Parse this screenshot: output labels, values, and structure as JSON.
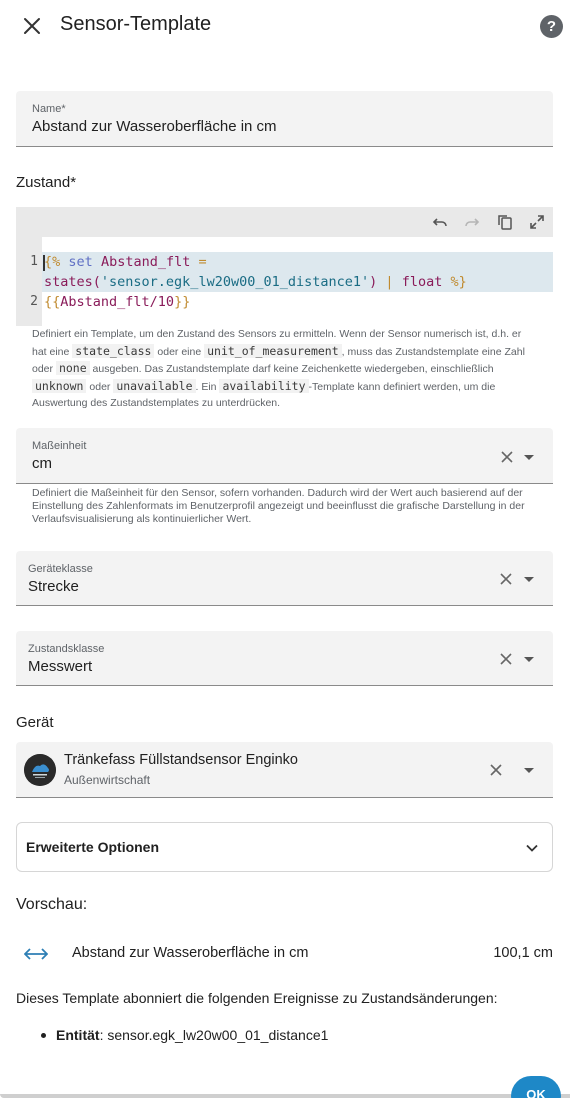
{
  "dialog": {
    "title": "Sensor-Template",
    "help_label": "?"
  },
  "name_field": {
    "label": "Name*",
    "value": "Abstand zur Wasseroberfläche in cm"
  },
  "state": {
    "section_label": "Zustand*",
    "code_lines": [
      {
        "number": "1"
      },
      {
        "number": "2"
      }
    ],
    "code": {
      "l1a_open": "{%",
      "l1a_kw": "set",
      "l1a_var": "Abstand_flt",
      "l1a_eq": "=",
      "l1b_fn": "states(",
      "l1b_str": "'sensor.egk_lw20w00_01_distance1'",
      "l1b_close": ")",
      "l1b_pipe": "|",
      "l1b_filter": "float",
      "l1b_end": "%}",
      "l2_open": "{{",
      "l2_expr": "Abstand_flt/10",
      "l2_close": "}}"
    },
    "helper": {
      "t1": "Definiert ein Template, um den Zustand des Sensors zu ermitteln. Wenn der Sensor numerisch ist, d.h. er hat eine ",
      "c1": "state_class",
      "t2": " oder eine ",
      "c2": "unit_of_measurement",
      "t3": ", muss das Zustandstemplate eine Zahl oder ",
      "c3": "none",
      "t4": " ausgeben. Das Zustandstemplate darf keine Zeichenkette wiedergeben, einschließlich ",
      "c4": "unknown",
      "t5": " oder ",
      "c5": "unavailable",
      "t6": ". Ein ",
      "c6": "availability",
      "t7": "-Template kann definiert werden, um die Auswertung des Zustandstemplates zu unterdrücken."
    }
  },
  "unit_field": {
    "label": "Maßeinheit",
    "value": "cm",
    "helper": "Definiert die Maßeinheit für den Sensor, sofern vorhanden. Dadurch wird der Wert auch basierend auf der Einstellung des Zahlenformats im Benutzerprofil angezeigt und beeinflusst die grafische Darstellung in der Verlaufsvisualisierung als kontinuierlicher Wert."
  },
  "device_class_field": {
    "label": "Geräteklasse",
    "value": "Strecke"
  },
  "state_class_field": {
    "label": "Zustandsklasse",
    "value": "Messwert"
  },
  "device": {
    "section_label": "Gerät",
    "name": "Tränkefass Füllstandsensor Enginko",
    "area": "Außenwirtschaft"
  },
  "advanced": {
    "label": "Erweiterte Optionen"
  },
  "preview": {
    "title": "Vorschau:",
    "entity_name": "Abstand zur Wasseroberfläche in cm",
    "entity_value": "100,1 cm"
  },
  "events": {
    "intro": "Dieses Template abonniert die folgenden Ereignisse zu Zustandsänderungen:",
    "entity_label": "Entität",
    "entity_sep": ": ",
    "entity_id": "sensor.egk_lw20w00_01_distance1"
  },
  "footer": {
    "ok_label": "OK"
  },
  "icons": {
    "close": "close-icon",
    "help": "help-icon",
    "undo": "undo-icon",
    "redo": "redo-icon",
    "copy": "copy-icon",
    "fullscreen": "fullscreen-icon",
    "clear": "clear-icon",
    "dropdown": "chevron-down-icon",
    "distance": "arrow-left-right-icon"
  },
  "colors": {
    "accent": "#1e88c7",
    "field_bg": "#f3f3f3",
    "distance_icon": "#2e7fb5"
  }
}
